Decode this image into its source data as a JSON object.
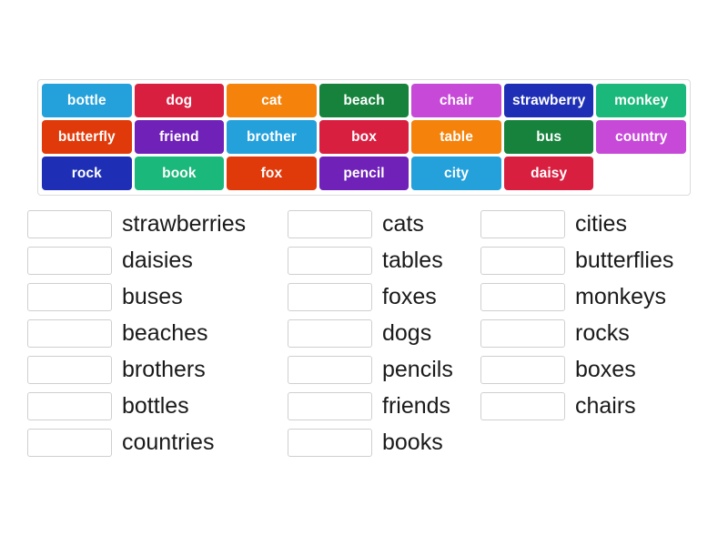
{
  "activity": {
    "type": "match-up-plurals",
    "wordbank": {
      "rows": [
        [
          {
            "label": "bottle",
            "color": "#24a0db"
          },
          {
            "label": "dog",
            "color": "#d81f40"
          },
          {
            "label": "cat",
            "color": "#f4820b"
          },
          {
            "label": "beach",
            "color": "#16823c"
          },
          {
            "label": "chair",
            "color": "#c749d8"
          },
          {
            "label": "strawberry",
            "color": "#1e2fb5"
          },
          {
            "label": "monkey",
            "color": "#1ab87a"
          }
        ],
        [
          {
            "label": "butterfly",
            "color": "#e03a0a"
          },
          {
            "label": "friend",
            "color": "#6f21b8"
          },
          {
            "label": "brother",
            "color": "#24a0db"
          },
          {
            "label": "box",
            "color": "#d81f40"
          },
          {
            "label": "table",
            "color": "#f4820b"
          },
          {
            "label": "bus",
            "color": "#16823c"
          },
          {
            "label": "country",
            "color": "#c749d8"
          }
        ],
        [
          {
            "label": "rock",
            "color": "#1e2fb5"
          },
          {
            "label": "book",
            "color": "#1ab87a"
          },
          {
            "label": "fox",
            "color": "#e03a0a"
          },
          {
            "label": "pencil",
            "color": "#6f21b8"
          },
          {
            "label": "city",
            "color": "#24a0db"
          },
          {
            "label": "daisy",
            "color": "#d81f40"
          },
          {
            "label": "",
            "color": "#ffffff",
            "empty": true
          }
        ]
      ]
    },
    "answers": {
      "columns": [
        {
          "items": [
            {
              "label": "strawberries",
              "value": ""
            },
            {
              "label": "daisies",
              "value": ""
            },
            {
              "label": "buses",
              "value": ""
            },
            {
              "label": "beaches",
              "value": ""
            },
            {
              "label": "brothers",
              "value": ""
            },
            {
              "label": "bottles",
              "value": ""
            },
            {
              "label": "countries",
              "value": ""
            }
          ]
        },
        {
          "items": [
            {
              "label": "cats",
              "value": ""
            },
            {
              "label": "tables",
              "value": ""
            },
            {
              "label": "foxes",
              "value": ""
            },
            {
              "label": "dogs",
              "value": ""
            },
            {
              "label": "pencils",
              "value": ""
            },
            {
              "label": "friends",
              "value": ""
            },
            {
              "label": "books",
              "value": ""
            }
          ]
        },
        {
          "items": [
            {
              "label": "cities",
              "value": ""
            },
            {
              "label": "butterflies",
              "value": ""
            },
            {
              "label": "monkeys",
              "value": ""
            },
            {
              "label": "rocks",
              "value": ""
            },
            {
              "label": "boxes",
              "value": ""
            },
            {
              "label": "chairs",
              "value": ""
            }
          ]
        }
      ]
    }
  }
}
